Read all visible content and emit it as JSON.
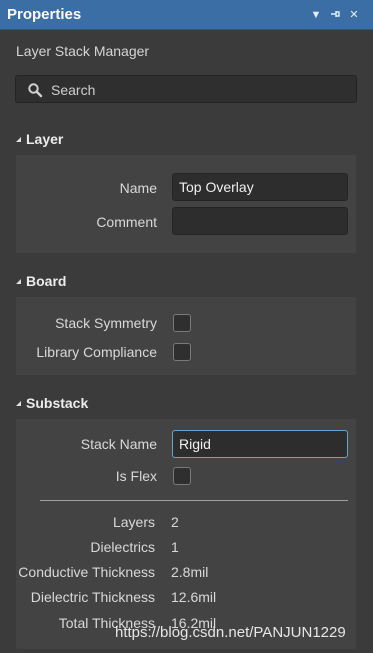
{
  "window": {
    "title": "Properties",
    "controls": [
      "dropdown-icon",
      "pin-icon",
      "close-icon"
    ]
  },
  "subtitle": "Layer Stack Manager",
  "search": {
    "placeholder": "Search",
    "value": ""
  },
  "sections": {
    "layer": {
      "title": "Layer",
      "name_label": "Name",
      "name_value": "Top Overlay",
      "comment_label": "Comment",
      "comment_value": ""
    },
    "board": {
      "title": "Board",
      "stack_symmetry_label": "Stack Symmetry",
      "stack_symmetry_checked": false,
      "library_compliance_label": "Library Compliance",
      "library_compliance_checked": false
    },
    "substack": {
      "title": "Substack",
      "stack_name_label": "Stack Name",
      "stack_name_value": "Rigid",
      "is_flex_label": "Is Flex",
      "is_flex_checked": false,
      "stats": {
        "layers_label": "Layers",
        "layers_value": "2",
        "dielectrics_label": "Dielectrics",
        "dielectrics_value": "1",
        "conductive_label": "Conductive Thickness",
        "conductive_value": "2.8mil",
        "dielectric_label": "Dielectric Thickness",
        "dielectric_value": "12.6mil",
        "total_label": "Total Thickness",
        "total_value": "16.2mil"
      }
    }
  },
  "watermark": "https://blog.csdn.net/PANJUN1229",
  "colors": {
    "titlebar": "#3b6ea5",
    "background": "#3b3b3b",
    "panel": "#434343",
    "focus_border": "#6f9fd3"
  }
}
